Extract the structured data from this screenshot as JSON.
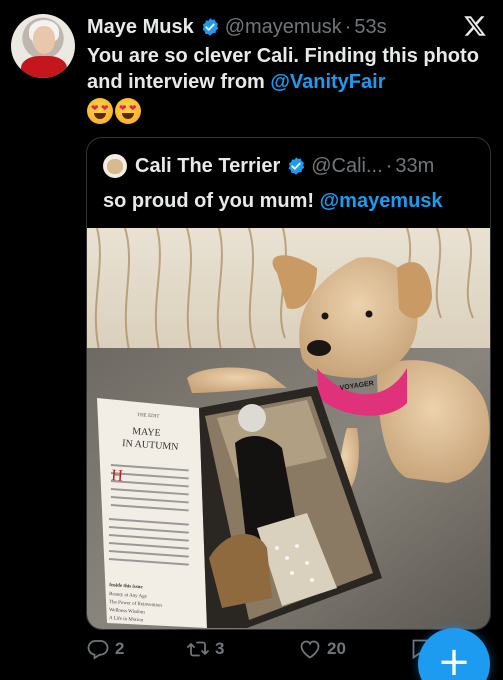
{
  "tweet": {
    "author_name": "Maye Musk",
    "author_handle": "@mayemusk",
    "separator": "·",
    "time": "53s",
    "text_part1": "You are so clever Cali. Finding this photo and interview from ",
    "mention": "@VanityFair",
    "emojis": [
      "smiling-face-with-heart-eyes",
      "smiling-face-with-heart-eyes"
    ],
    "verified_color": "#1d9bf0"
  },
  "quoted": {
    "author_name": "Cali The Terrier",
    "author_handle": "@Cali...",
    "separator": "·",
    "time": "33m",
    "text_part1": "so proud of you mum! ",
    "mention": "@mayemusk"
  },
  "photo": {
    "magazine": {
      "kicker": "THE EDIT",
      "headline_line1": "MAYE",
      "headline_line2": "IN AUTUMN",
      "inside_heading": "Inside this issue",
      "inside_items": [
        "Beauty at Any Age",
        "The Power of Reinvention",
        "Wellness Wisdom",
        "A Life in Motion"
      ]
    },
    "harness_text": "VOYAGER"
  },
  "actions": {
    "replies": "2",
    "retweets": "3",
    "likes": "20"
  },
  "fab": {
    "label": "+"
  },
  "colors": {
    "accent": "#1d9bf0",
    "muted": "#71767b",
    "text": "#e7e9ea",
    "border": "#2f3336"
  }
}
